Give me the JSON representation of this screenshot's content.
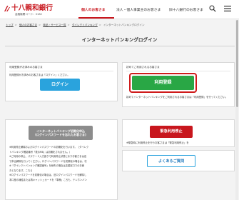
{
  "header": {
    "bank_name": "十八親和銀行",
    "bank_code": "金融機関コード：0182",
    "nav": [
      "個人のお客さま",
      "法人・個人事業主のお客さま",
      "旧十八銀行のお客さま"
    ],
    "active_nav": "個人のお客さま",
    "brand_color": "#c8161d",
    "search_icon": "search-icon",
    "menu_icon": "hamburger-menu-icon"
  },
  "breadcrumb": [
    "トップ",
    "個人のお客さま",
    "商品・サービス一覧",
    "ダイレクトバンキング",
    "インターネットバンキングログイン"
  ],
  "page_title": "インターネットバンキングログイン",
  "cards": {
    "login": {
      "heading": "利用登録がお済みのお客さま",
      "note": "利用登録がお済みのお客さまは「ログイン」ください。",
      "button": "ログイン",
      "button_color": "#2aa3dd"
    },
    "register": {
      "heading": "初めてご利用されるお客さま",
      "note": "初めてインターネットバンキングをご利用されるお客さまは「利用登録」を行ってください。",
      "button": "利用登録",
      "button_color": "#29a745",
      "highlight_color": "#cf1b1b"
    },
    "unlock": {
      "button_line1": "インターネットバンキング初期化申込",
      "button_line2": "(ログインパスワードを忘れたお客さま)",
      "rules": [
        "※利用停止解除およびログインパスワードの初期化を行います。（ダイレク",
        "トバンキング確認番号「表示M8」は初期化されません。）",
        "※ご利用の停止、パスワード入力誤りで利用停止状態となりお客さまは店",
        "で申込解除を行ってください。ログインパスワードを初期化の場合は、次",
        "※「ダイレクトバンキング確認番号」を紛失の場合は店頭窓口での手続",
        "きとなります。こちら",
        "※ログインパスワードを初期化の場合は、旧ログインパスワードを解除し",
        "本口座の凍結または再キャッシュカードを「準備」ころも、テレホンバン"
      ],
      "rule_link": "こちら"
    },
    "emergency": {
      "note": "※緊急時に利用停止を行うお客さまは「緊急利用停止」を",
      "button": "緊急利用停止",
      "button_color": "#c8161d"
    },
    "faq": {
      "button": "よくあるご質問"
    }
  }
}
